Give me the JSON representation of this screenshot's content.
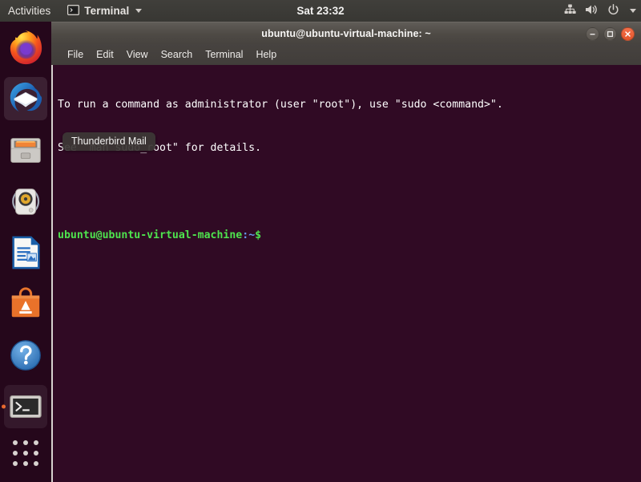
{
  "top_panel": {
    "activities_label": "Activities",
    "app_menu": {
      "label": "Terminal",
      "icon": "terminal-icon",
      "arrow": "chevron-down-icon"
    },
    "clock": "Sat 23:32",
    "tray_icons": [
      "network-wired-icon",
      "volume-icon",
      "power-icon",
      "chevron-down-icon"
    ],
    "panel_color": "#3c3b37"
  },
  "dock": {
    "background_color": "#210c1a",
    "running_indicator_color": "#e8662a",
    "items": [
      {
        "name": "firefox",
        "label": "Firefox Web Browser",
        "state": "idle"
      },
      {
        "name": "thunderbird",
        "label": "Thunderbird Mail",
        "state": "hovered"
      },
      {
        "name": "files",
        "label": "Files",
        "state": "idle"
      },
      {
        "name": "rhythmbox",
        "label": "Rhythmbox",
        "state": "idle"
      },
      {
        "name": "libreoffice-writer",
        "label": "LibreOffice Writer",
        "state": "idle"
      },
      {
        "name": "ubuntu-software",
        "label": "Ubuntu Software",
        "state": "idle"
      },
      {
        "name": "help",
        "label": "Help",
        "state": "idle"
      },
      {
        "name": "terminal",
        "label": "Terminal",
        "state": "running-active"
      }
    ],
    "show_applications_label": "Show Applications"
  },
  "tooltip": {
    "text": "Thunderbird Mail"
  },
  "terminal_window": {
    "title": "ubuntu@ubuntu-virtual-machine: ~",
    "window_controls": {
      "minimize": "minimize-icon",
      "maximize": "maximize-icon",
      "close": "close-icon"
    },
    "menu": [
      "File",
      "Edit",
      "View",
      "Search",
      "Terminal",
      "Help"
    ],
    "background_color": "#300a24",
    "content": {
      "line1": "To run a command as administrator (user \"root\"), use \"sudo <command>\".",
      "line2": "See \"man sudo_root\" for details.",
      "line3": "",
      "prompt_user": "ubuntu@ubuntu-virtual-machine",
      "prompt_path": ":~",
      "prompt_symbol": "$"
    }
  }
}
